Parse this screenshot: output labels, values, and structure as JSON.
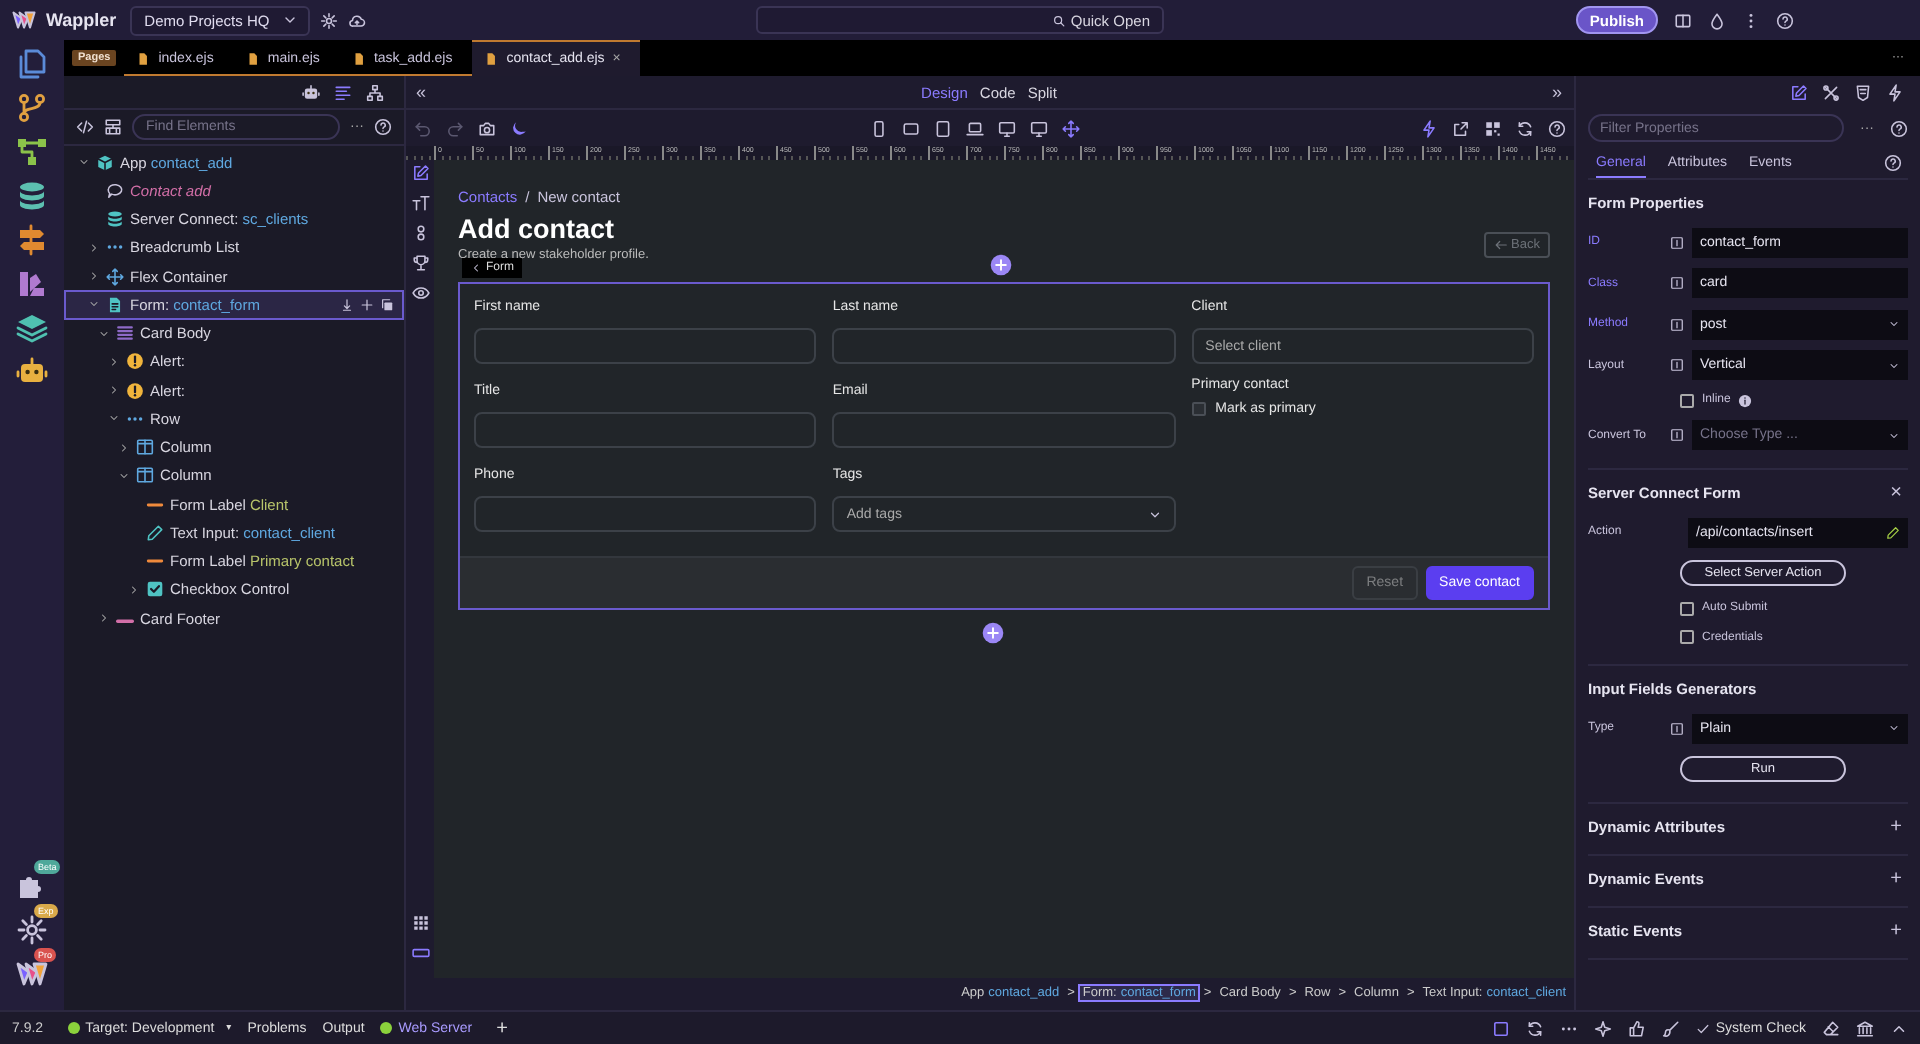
{
  "top_bar": {
    "app_name": "Wappler",
    "project": "Demo Projects HQ",
    "quick_open": "Quick Open",
    "publish": "Publish"
  },
  "activity_badges": [
    {
      "label": "Beta",
      "color": "#4fa89a"
    },
    {
      "label": "Exp",
      "color": "#d9a94a"
    },
    {
      "label": "Pro",
      "color": "#d9534f"
    }
  ],
  "file_tabs": {
    "group": "Pages",
    "tabs": [
      {
        "label": "index.ejs",
        "selected": false
      },
      {
        "label": "main.ejs",
        "selected": false
      },
      {
        "label": "task_add.ejs",
        "selected": false
      },
      {
        "label": "contact_add.ejs",
        "selected": true,
        "close": "×"
      }
    ],
    "overflow": "···"
  },
  "element_tree": {
    "search_placeholder": "Find Elements",
    "more": "···",
    "items": [
      {
        "kind": "app",
        "label": "App",
        "name": "contact_add",
        "expanded": true,
        "selected": false,
        "children": [
          {
            "kind": "comment",
            "label": "Contact add",
            "selected": false
          },
          {
            "kind": "server_connect",
            "label": "Server Connect:",
            "name": "sc_clients",
            "selected": false
          },
          {
            "kind": "breadcrumb",
            "label": "Breadcrumb List",
            "expanded": false,
            "selected": false
          },
          {
            "kind": "flex",
            "label": "Flex Container",
            "expanded": false,
            "selected": false
          },
          {
            "kind": "form",
            "label": "Form:",
            "name": "contact_form",
            "expanded": true,
            "selected": true,
            "children": [
              {
                "kind": "card_body",
                "label": "Card Body",
                "expanded": true,
                "selected": false,
                "children": [
                  {
                    "kind": "alert",
                    "label": "Alert:",
                    "expanded": false,
                    "selected": false
                  },
                  {
                    "kind": "alert",
                    "label": "Alert:",
                    "expanded": false,
                    "selected": false
                  },
                  {
                    "kind": "row",
                    "label": "Row",
                    "expanded": true,
                    "selected": false,
                    "children": [
                      {
                        "kind": "column",
                        "label": "Column",
                        "expanded": false,
                        "selected": false
                      },
                      {
                        "kind": "column",
                        "label": "Column",
                        "expanded": true,
                        "selected": false,
                        "children": [
                          {
                            "kind": "label",
                            "label": "Form Label",
                            "name": "Client",
                            "selected": false
                          },
                          {
                            "kind": "text_input",
                            "label": "Text Input:",
                            "name": "contact_client",
                            "selected": false
                          },
                          {
                            "kind": "label",
                            "label": "Form Label",
                            "name": "Primary contact",
                            "selected": false
                          },
                          {
                            "kind": "checkbox",
                            "label": "Checkbox Control",
                            "expanded": false,
                            "selected": false
                          }
                        ]
                      }
                    ]
                  }
                ]
              },
              {
                "kind": "card_footer",
                "label": "Card Footer",
                "expanded": false,
                "selected": false
              }
            ]
          }
        ]
      }
    ]
  },
  "design_view": {
    "collapse": "«",
    "expand": "»",
    "modes": [
      {
        "label": "Design",
        "selected": true
      },
      {
        "label": "Code",
        "selected": false
      },
      {
        "label": "Split",
        "selected": false
      }
    ],
    "ruler_marks": [
      "0",
      "50",
      "100",
      "150",
      "200",
      "250",
      "300",
      "350",
      "400",
      "450",
      "500",
      "550",
      "600",
      "650",
      "700",
      "750",
      "800",
      "850",
      "900",
      "950",
      "1000",
      "1050",
      "1100",
      "1150",
      "1200",
      "1250",
      "1300",
      "1350",
      "1400",
      "1450"
    ],
    "page": {
      "breadcrumb": [
        {
          "label": "Contacts",
          "link": true
        },
        {
          "label": "New contact",
          "link": false
        }
      ],
      "separator": "/",
      "title": "Add contact",
      "subtitle": "Create a new stakeholder profile.",
      "back": "Back",
      "form_tag": "Form",
      "fields": [
        {
          "kind": "input",
          "label": "First name"
        },
        {
          "kind": "input",
          "label": "Last name"
        },
        {
          "kind": "input",
          "label": "Client",
          "placeholder": "Select client"
        },
        {
          "kind": "input",
          "label": "Title"
        },
        {
          "kind": "input",
          "label": "Email"
        },
        {
          "kind": "checkbox",
          "label": "Primary contact",
          "option": "Mark as primary",
          "checked": false
        },
        {
          "kind": "input",
          "label": "Phone"
        },
        {
          "kind": "select",
          "label": "Tags",
          "placeholder": "Add tags"
        }
      ],
      "buttons": [
        {
          "label": "Reset",
          "kind": "secondary",
          "disabled": true
        },
        {
          "label": "Save contact",
          "kind": "primary",
          "disabled": false
        }
      ]
    },
    "element_path": {
      "separator": ">",
      "items": [
        {
          "label": "App",
          "name": "contact_add",
          "selected": false
        },
        {
          "label": "Form:",
          "name": "contact_form",
          "selected": true
        },
        {
          "label": "Card Body",
          "selected": false
        },
        {
          "label": "Row",
          "selected": false
        },
        {
          "label": "Column",
          "selected": false
        },
        {
          "label": "Text Input:",
          "name": "contact_client",
          "selected": false
        }
      ]
    }
  },
  "properties": {
    "filter_placeholder": "Filter Properties",
    "more": "···",
    "tabs": [
      {
        "label": "General",
        "selected": true
      },
      {
        "label": "Attributes",
        "selected": false
      },
      {
        "label": "Events",
        "selected": false
      }
    ],
    "sections": [
      {
        "title": "Form Properties",
        "rows": [
          {
            "kind": "text",
            "label": "ID",
            "value": "contact_form",
            "modified": true
          },
          {
            "kind": "text",
            "label": "Class",
            "value": "card",
            "modified": true
          },
          {
            "kind": "select",
            "label": "Method",
            "value": "post",
            "modified": true
          },
          {
            "kind": "select",
            "label": "Layout",
            "value": "Vertical",
            "modified": false
          },
          {
            "kind": "checkbox",
            "label": "Inline",
            "checked": false,
            "info": true
          },
          {
            "kind": "select",
            "label": "Convert To",
            "placeholder": "Choose Type ...",
            "modified": false
          }
        ]
      },
      {
        "title": "Server Connect Form",
        "glyph": "×",
        "rows": [
          {
            "kind": "action",
            "label": "Action",
            "value": "/api/contacts/insert"
          },
          {
            "kind": "button",
            "label": "Select Server Action"
          },
          {
            "kind": "checkbox",
            "label": "Auto Submit",
            "checked": false
          },
          {
            "kind": "checkbox",
            "label": "Credentials",
            "checked": false
          }
        ]
      },
      {
        "title": "Input Fields Generators",
        "rows": [
          {
            "kind": "select",
            "label": "Type",
            "value": "Plain",
            "modified": false
          },
          {
            "kind": "button",
            "label": "Run"
          }
        ]
      },
      {
        "title": "Dynamic Attributes",
        "glyph": "+"
      },
      {
        "title": "Dynamic Events",
        "glyph": "+"
      },
      {
        "title": "Static Events",
        "glyph": "+"
      }
    ]
  },
  "status_bar": {
    "version": "7.9.2",
    "target": "Target: Development",
    "target_caret": "▾",
    "panels": [
      "Problems",
      "Output"
    ],
    "server": "Web Server",
    "server_running": true,
    "add": "+",
    "system_check": "System Check"
  }
}
